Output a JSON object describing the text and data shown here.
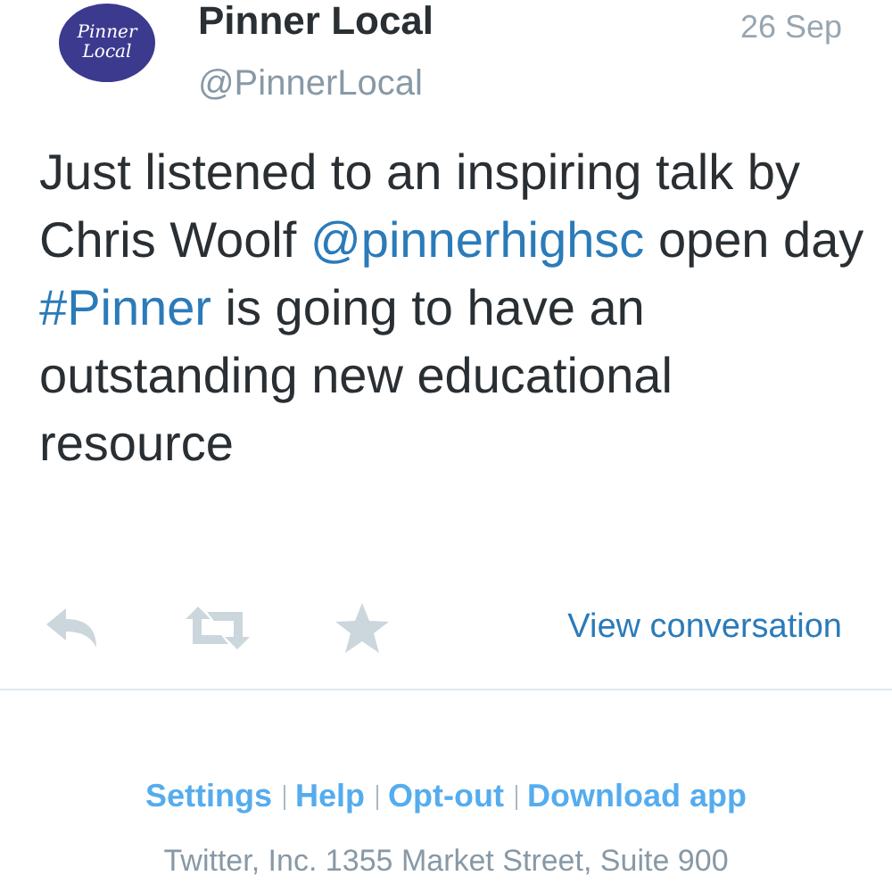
{
  "tweet": {
    "avatar_text": [
      "Pinner",
      "Local"
    ],
    "name": "Pinner Local",
    "handle": "@PinnerLocal",
    "date": "26 Sep",
    "body": [
      {
        "kind": "text",
        "text": "Just listened to an inspiring talk by Chris Woolf "
      },
      {
        "kind": "mention",
        "text": "@pinnerhighsc"
      },
      {
        "kind": "text",
        "text": " open day "
      },
      {
        "kind": "hashtag",
        "text": "#Pinner"
      },
      {
        "kind": "text",
        "text": " is going to have an outstanding new educational resource"
      }
    ],
    "actions": [
      {
        "kind": "reply"
      },
      {
        "kind": "retweet"
      },
      {
        "kind": "favorite"
      }
    ],
    "view_conversation": "View conversation"
  },
  "footer": {
    "links": [
      "Settings",
      "Help",
      "Opt-out",
      "Download app"
    ],
    "address": "Twitter, Inc. 1355 Market Street, Suite 900"
  }
}
